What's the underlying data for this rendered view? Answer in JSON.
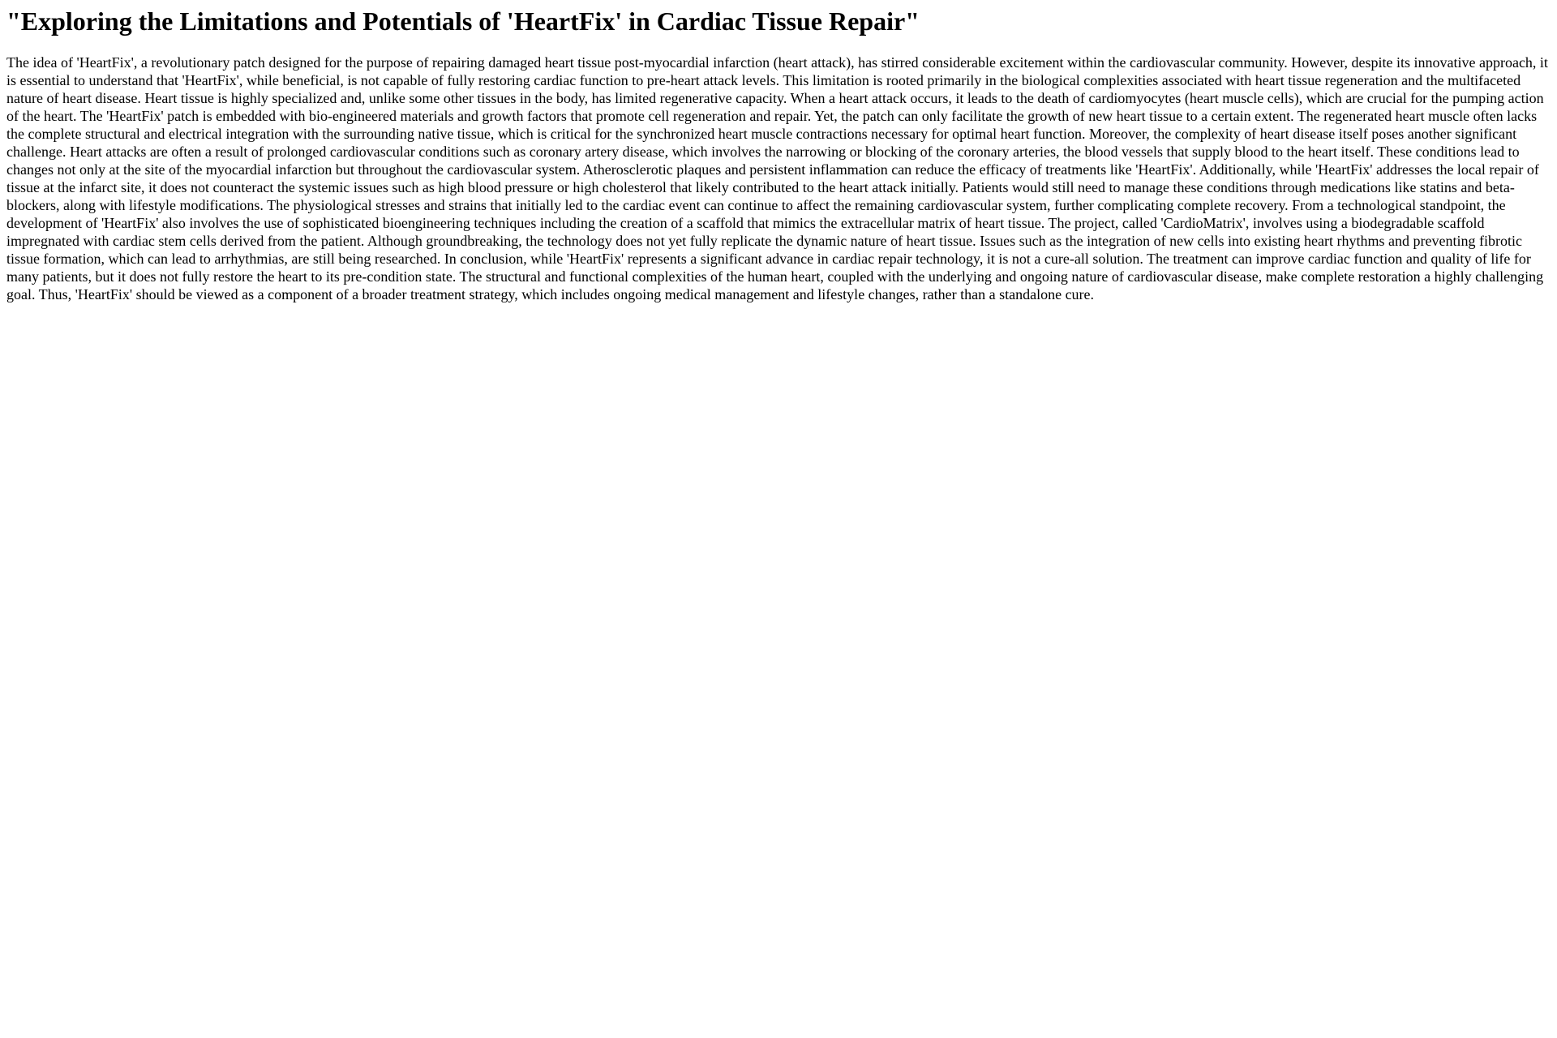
{
  "article": {
    "title": "\"Exploring the Limitations and Potentials of 'HeartFix' in Cardiac Tissue Repair\"",
    "body": "The idea of 'HeartFix', a revolutionary patch designed for the purpose of repairing damaged heart tissue post-myocardial infarction (heart attack), has stirred considerable excitement within the cardiovascular community. However, despite its innovative approach, it is essential to understand that 'HeartFix', while beneficial, is not capable of fully restoring cardiac function to pre-heart attack levels. This limitation is rooted primarily in the biological complexities associated with heart tissue regeneration and the multifaceted nature of heart disease. Heart tissue is highly specialized and, unlike some other tissues in the body, has limited regenerative capacity. When a heart attack occurs, it leads to the death of cardiomyocytes (heart muscle cells), which are crucial for the pumping action of the heart. The 'HeartFix' patch is embedded with bio-engineered materials and growth factors that promote cell regeneration and repair. Yet, the patch can only facilitate the growth of new heart tissue to a certain extent. The regenerated heart muscle often lacks the complete structural and electrical integration with the surrounding native tissue, which is critical for the synchronized heart muscle contractions necessary for optimal heart function. Moreover, the complexity of heart disease itself poses another significant challenge. Heart attacks are often a result of prolonged cardiovascular conditions such as coronary artery disease, which involves the narrowing or blocking of the coronary arteries, the blood vessels that supply blood to the heart itself. These conditions lead to changes not only at the site of the myocardial infarction but throughout the cardiovascular system. Atherosclerotic plaques and persistent inflammation can reduce the efficacy of treatments like 'HeartFix'. Additionally, while 'HeartFix' addresses the local repair of tissue at the infarct site, it does not counteract the systemic issues such as high blood pressure or high cholesterol that likely contributed to the heart attack initially. Patients would still need to manage these conditions through medications like statins and beta-blockers, along with lifestyle modifications. The physiological stresses and strains that initially led to the cardiac event can continue to affect the remaining cardiovascular system, further complicating complete recovery. From a technological standpoint, the development of 'HeartFix' also involves the use of sophisticated bioengineering techniques including the creation of a scaffold that mimics the extracellular matrix of heart tissue. The project, called 'CardioMatrix', involves using a biodegradable scaffold impregnated with cardiac stem cells derived from the patient. Although groundbreaking, the technology does not yet fully replicate the dynamic nature of heart tissue. Issues such as the integration of new cells into existing heart rhythms and preventing fibrotic tissue formation, which can lead to arrhythmias, are still being researched. In conclusion, while 'HeartFix' represents a significant advance in cardiac repair technology, it is not a cure-all solution. The treatment can improve cardiac function and quality of life for many patients, but it does not fully restore the heart to its pre-condition state. The structural and functional complexities of the human heart, coupled with the underlying and ongoing nature of cardiovascular disease, make complete restoration a highly challenging goal. Thus, 'HeartFix' should be viewed as a component of a broader treatment strategy, which includes ongoing medical management and lifestyle changes, rather than a standalone cure."
  }
}
